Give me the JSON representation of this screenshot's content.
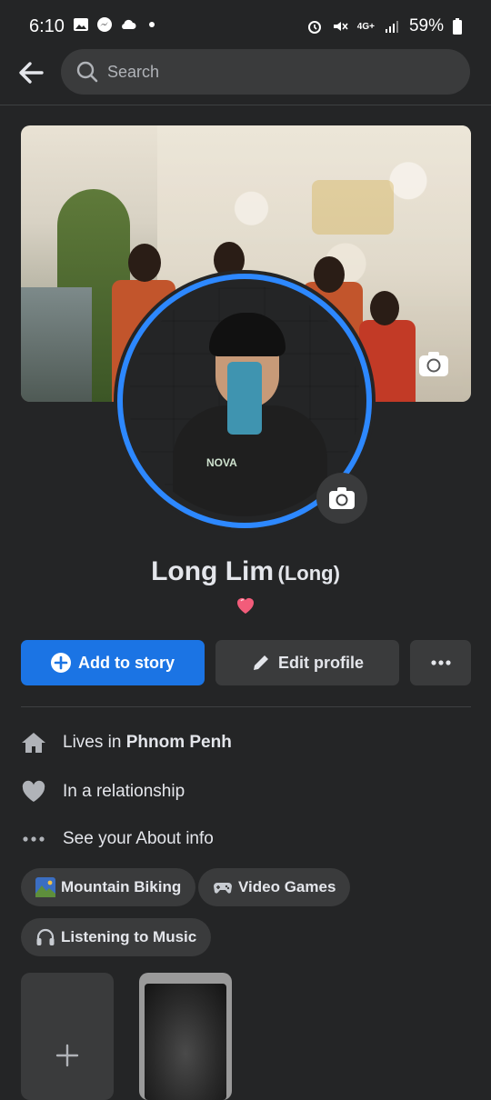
{
  "status_bar": {
    "time": "6:10",
    "battery": "59%",
    "network": "4G+"
  },
  "top_bar": {
    "search_placeholder": "Search"
  },
  "profile": {
    "name": "Long Lim",
    "alternate_name": "(Long)",
    "status_emoji": "heart"
  },
  "actions": {
    "add_story_label": "Add to story",
    "edit_profile_label": "Edit profile",
    "more_label": "More"
  },
  "details": {
    "lives_in_prefix": "Lives in",
    "lives_in_city": "Phnom Penh",
    "relationship": "In a relationship",
    "about": "See your About info"
  },
  "hobbies": [
    {
      "label": "Mountain Biking",
      "icon": "mountain-landscape-icon"
    },
    {
      "label": "Video Games",
      "icon": "gamepad-icon"
    },
    {
      "label": "Listening to Music",
      "icon": "headphones-icon"
    }
  ],
  "hoodie_print": "NOVA",
  "colors": {
    "background": "#242526",
    "primary_button": "#1b74e4",
    "secondary_button": "#3a3b3c",
    "avatar_ring": "#2d88ff",
    "text": "#e4e6eb"
  }
}
